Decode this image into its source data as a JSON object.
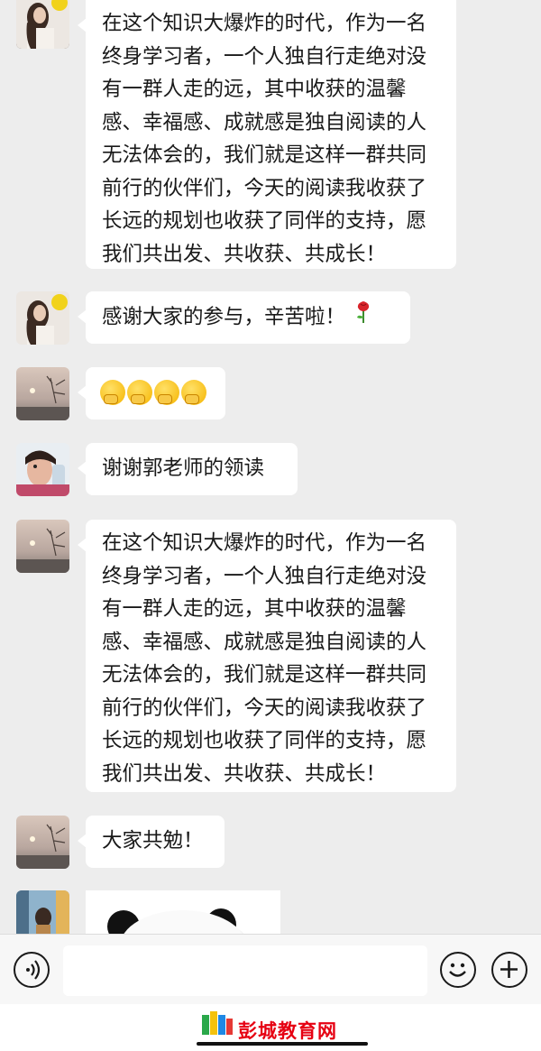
{
  "messages": [
    {
      "text": "在这个知识大爆炸的时代，作为一名终身学习者，一个人独自行走绝对没有一群人走的远，其中收获的温馨感、幸福感、成就感是独自阅读的人无法体会的，我们就是这样一群共同前行的伙伴们，今天的阅读我收获了长远的规划也收获了同伴的支持，愿我们共出发、共收获、共成长！"
    },
    {
      "text": "感谢大家的参与，辛苦啦！",
      "emoji": "rose-icon"
    },
    {
      "emoji": "sneezing-face-icon x4"
    },
    {
      "text": "谢谢郭老师的领读"
    },
    {
      "text": "在这个知识大爆炸的时代，作为一名终身学习者，一个人独自行走绝对没有一群人走的远，其中收获的温馨感、幸福感、成就感是独自阅读的人无法体会的，我们就是这样一群共同前行的伙伴们，今天的阅读我收获了长远的规划也收获了同伴的支持，愿我们共出发、共收获、共成长！"
    },
    {
      "text": "大家共勉！"
    },
    {
      "sticker": "panda-sticker"
    }
  ],
  "toolbar": {
    "voice_icon": "voice-icon",
    "emoji_icon": "emoji-icon",
    "plus_icon": "plus-icon",
    "input_value": ""
  },
  "watermark": {
    "text": "彭城教育网"
  },
  "colors": {
    "background": "#ededed",
    "bubble": "#ffffff",
    "watermark_red": "#e60012"
  }
}
